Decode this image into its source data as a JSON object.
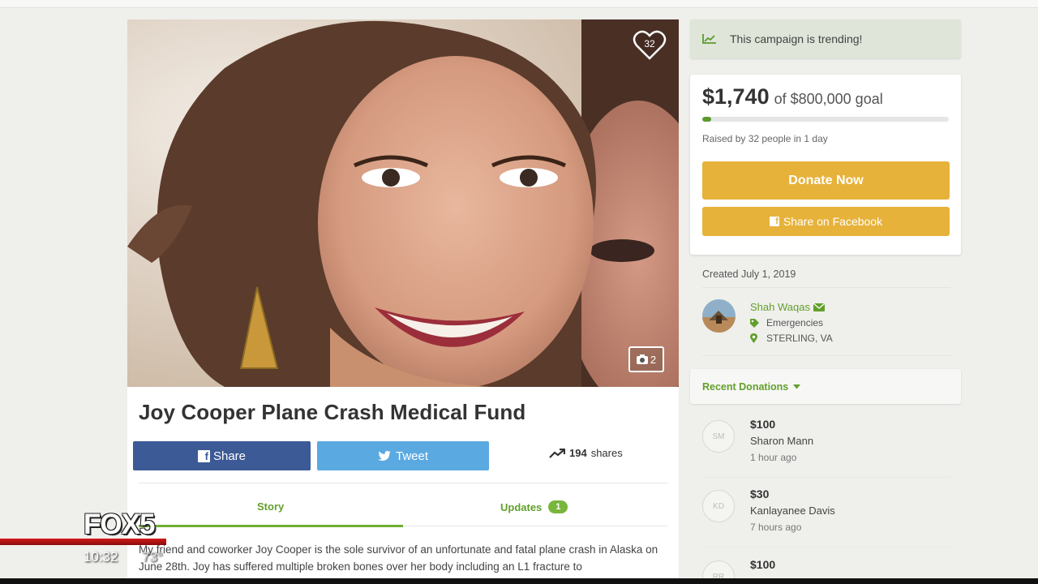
{
  "campaign": {
    "title": "Joy Cooper Plane Crash Medical Fund",
    "hearts": "32",
    "photo_count": "2",
    "share_fb_label": "Share",
    "tweet_label": "Tweet",
    "shares_count": "194",
    "shares_label": "shares",
    "tabs": {
      "story": "Story",
      "updates": "Updates",
      "updates_count": "1"
    },
    "story_text": "My friend and coworker Joy Cooper is the sole survivor of an unfortunate and fatal plane crash in Alaska on June 28th. Joy has suffered multiple broken bones over her body including an L1 fracture to"
  },
  "sidebar": {
    "trending": "This campaign is trending!",
    "raised": "$1,740",
    "goal": "of $800,000 goal",
    "progress_fraction": 0.002175,
    "raised_by": "Raised by 32 people in 1 day",
    "donate_label": "Donate Now",
    "fb_share_label": "Share on Facebook",
    "created": "Created July 1, 2019",
    "organizer": {
      "name": "Shah Waqas",
      "category": "Emergencies",
      "location": "STERLING, VA"
    },
    "recent_label": "Recent Donations",
    "donations": [
      {
        "initials": "SM",
        "amount": "$100",
        "name": "Sharon Mann",
        "time": "1 hour ago"
      },
      {
        "initials": "KD",
        "amount": "$30",
        "name": "Kanlayanee Davis",
        "time": "7 hours ago"
      },
      {
        "initials": "RR",
        "amount": "$100",
        "name": "",
        "time": ""
      }
    ]
  },
  "broadcast": {
    "logo": "FOX5",
    "time": "10:32",
    "temp": "73°"
  },
  "colors": {
    "accent_green": "#62a02c",
    "donate_yellow": "#e6b23a",
    "facebook_blue": "#3c5a96",
    "twitter_blue": "#5ba9e1"
  }
}
